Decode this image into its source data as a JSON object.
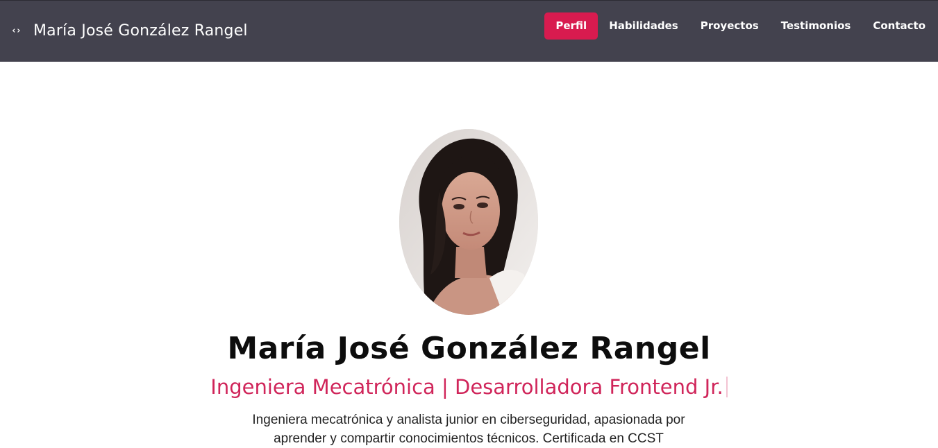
{
  "header": {
    "brand_icon": "‹›",
    "brand_name": "María José González Rangel",
    "nav": [
      {
        "label": "Perfil",
        "active": true
      },
      {
        "label": "Habilidades",
        "active": false
      },
      {
        "label": "Proyectos",
        "active": false
      },
      {
        "label": "Testimonios",
        "active": false
      },
      {
        "label": "Contacto",
        "active": false
      }
    ],
    "bg_color": "#43424e",
    "accent_color": "#d81b4f"
  },
  "hero": {
    "name": "María José González Rangel",
    "role": "Ingeniera Mecatrónica | Desarrolladora Frontend Jr.",
    "description": "Ingeniera mecatrónica y analista junior en ciberseguridad, apasionada por aprender y compartir conocimientos técnicos. Certificada en CCST",
    "role_color": "#d0255a"
  }
}
